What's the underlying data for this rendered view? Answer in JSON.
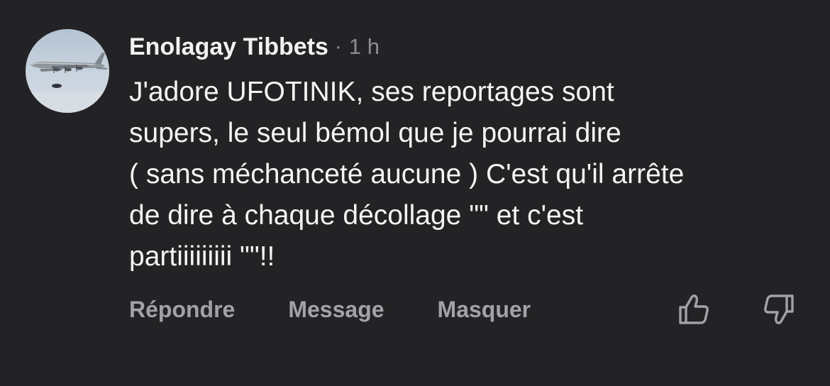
{
  "comment": {
    "author": "Enolagay Tibbets",
    "separator": "·",
    "time": "1 h",
    "text": "J'adore UFOTINIK, ses reportages sont\nsupers, le seul bémol que je pourrai dire\n( sans méchanceté aucune ) C'est qu'il arrête\nde dire à chaque décollage \"\" et c'est\npartiiiiiiiii \"\"!!"
  },
  "actions": {
    "reply": "Répondre",
    "message": "Message",
    "hide": "Masquer"
  },
  "icons": {
    "avatar": "airplane-photo",
    "like": "thumbs-up-icon",
    "dislike": "thumbs-down-icon"
  },
  "colors": {
    "background": "#232325",
    "text": "#f4f4f4",
    "muted": "#a2a2a7"
  }
}
